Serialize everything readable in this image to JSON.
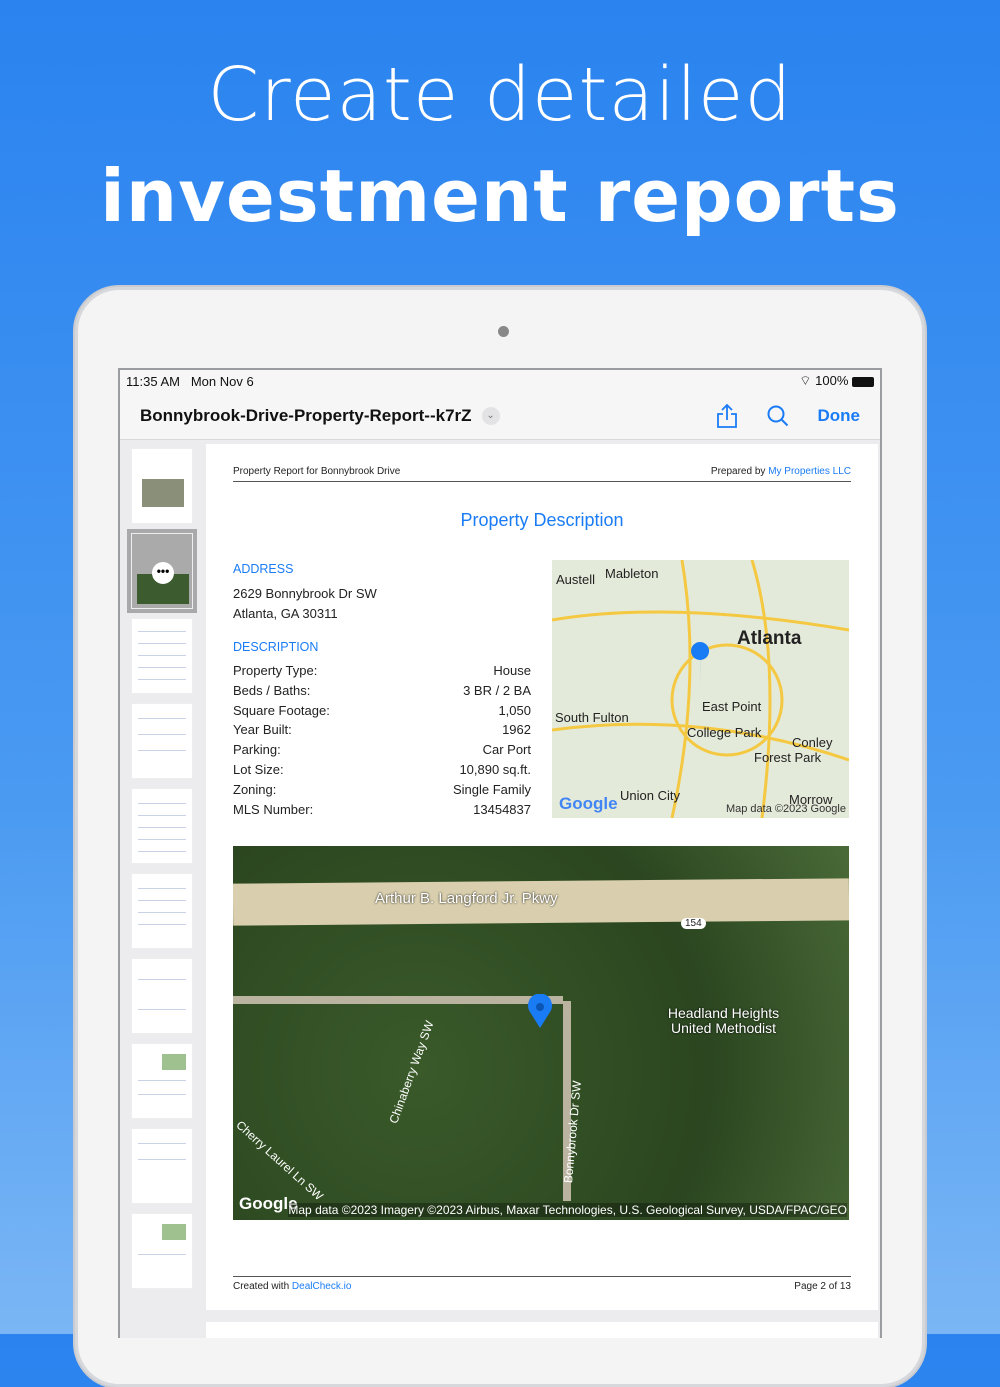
{
  "hero": {
    "line1": "Create detailed",
    "line2": "investment reports"
  },
  "status": {
    "time": "11:35 AM",
    "date": "Mon Nov 6",
    "battery": "100%"
  },
  "nav": {
    "title": "Bonnybrook-Drive-Property-Report--k7rZ",
    "done": "Done"
  },
  "page": {
    "header_left": "Property Report for Bonnybrook Drive",
    "prepared_by": "Prepared by",
    "company": "My Properties LLC",
    "title": "Property Description",
    "address_label": "ADDRESS",
    "address1": "2629 Bonnybrook Dr SW",
    "address2": "Atlanta, GA 30311",
    "description_label": "DESCRIPTION",
    "rows": [
      {
        "k": "Property Type:",
        "v": "House"
      },
      {
        "k": "Beds / Baths:",
        "v": "3 BR / 2 BA"
      },
      {
        "k": "Square Footage:",
        "v": "1,050"
      },
      {
        "k": "Year Built:",
        "v": "1962"
      },
      {
        "k": "Parking:",
        "v": "Car Port"
      },
      {
        "k": "Lot Size:",
        "v": "10,890 sq.ft."
      },
      {
        "k": "Zoning:",
        "v": "Single Family"
      },
      {
        "k": "MLS Number:",
        "v": "13454837"
      }
    ],
    "footer_created": "Created with",
    "footer_link": "DealCheck.io",
    "page_num": "Page 2 of 13"
  },
  "map": {
    "labels": [
      "Austell",
      "Mableton",
      "Atlanta",
      "East Point",
      "South Fulton",
      "College Park",
      "Conley",
      "Forest Park",
      "Union City",
      "Morrow"
    ],
    "credit": "Map data ©2023 Google",
    "logo": "Google"
  },
  "sat": {
    "roads": [
      "Arthur B. Langford Jr. Pkwy",
      "Chinaberry Way SW",
      "Bonnybrook Dr SW",
      "Cherry Laurel Ln SW"
    ],
    "poi": "Headland Heights United Methodist",
    "shield": "154",
    "credit": "Map data ©2023 Imagery ©2023 Airbus, Maxar Technologies, U.S. Geological Survey, USDA/FPAC/GEO",
    "logo": "Google"
  }
}
